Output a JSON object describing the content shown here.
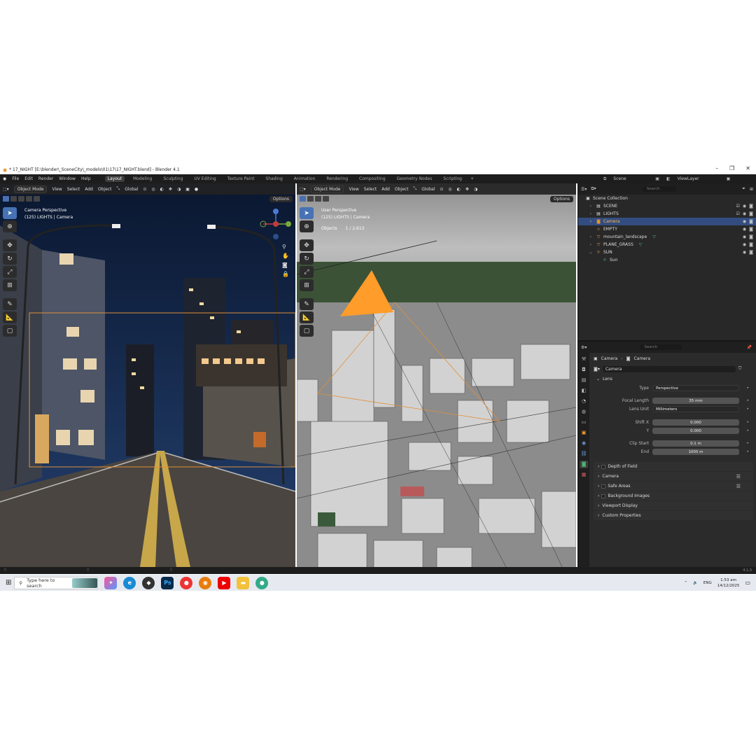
{
  "window": {
    "title": "* 17_NIGHT [E:\\blender\\_SceneCity\\_models\\01\\17\\17_NIGHT.blend] - Blender 4.1"
  },
  "menu": [
    "File",
    "Edit",
    "Render",
    "Window",
    "Help"
  ],
  "workspaces": [
    "Layout",
    "Modeling",
    "Sculpting",
    "UV Editing",
    "Texture Paint",
    "Shading",
    "Animation",
    "Rendering",
    "Compositing",
    "Geometry Nodes",
    "Scripting"
  ],
  "topright": {
    "scene": "Scene",
    "viewlayer": "ViewLayer"
  },
  "viewport_left": {
    "mode": "Object Mode",
    "menus": [
      "View",
      "Select",
      "Add",
      "Object"
    ],
    "transform": "Global",
    "options": "Options",
    "overlay_line1": "Camera Perspective",
    "overlay_line2": "(125) LIGHTS | Camera"
  },
  "viewport_right": {
    "mode": "Object Mode",
    "menus": [
      "View",
      "Select",
      "Add",
      "Object"
    ],
    "transform": "Global",
    "options": "Options",
    "overlay_line1": "User Perspective",
    "overlay_line2": "(125) LIGHTS | Camera",
    "objects_label": "Objects",
    "objects_count": "1 / 2,613"
  },
  "outliner": {
    "search_placeholder": "Search",
    "root": "Scene Collection",
    "items": [
      {
        "label": "SCENE",
        "icon": "collection-icon"
      },
      {
        "label": "LIGHTS",
        "icon": "collection-icon"
      },
      {
        "label": "Camera",
        "icon": "camera-icon"
      },
      {
        "label": "EMPTY",
        "icon": "empty-icon"
      },
      {
        "label": "mountain_landscape",
        "icon": "mesh-icon"
      },
      {
        "label": "PLANE_GRASS",
        "icon": "mesh-icon"
      },
      {
        "label": "SUN",
        "icon": "light-icon"
      },
      {
        "label": "Sun",
        "icon": "light-data-icon"
      }
    ]
  },
  "properties": {
    "search_placeholder": "Search",
    "breadcrumb_object": "Camera",
    "breadcrumb_data": "Camera",
    "datablock": "Camera",
    "lens_header": "Lens",
    "type_label": "Type",
    "type_value": "Perspective",
    "focal_label": "Focal Length",
    "focal_value": "35 mm",
    "lensunit_label": "Lens Unit",
    "lensunit_value": "Millimeters",
    "shiftx_label": "Shift X",
    "shiftx_value": "0.000",
    "shifty_label": "Y",
    "shifty_value": "0.000",
    "clipstart_label": "Clip Start",
    "clipstart_value": "0.1 m",
    "clipend_label": "End",
    "clipend_value": "1000 m",
    "panels": [
      "Depth of Field",
      "Camera",
      "Safe Areas",
      "Background Images",
      "Viewport Display",
      "Custom Properties"
    ]
  },
  "status": {
    "version": "4.1.0"
  },
  "taskbar": {
    "search_placeholder": "Type here to search",
    "language": "ENG",
    "time": "1:53 am",
    "date": "14/12/2025"
  },
  "colors": {
    "accent": "#4772b3",
    "camera_orange": "#ff9c2a",
    "selection": "#334d80"
  }
}
